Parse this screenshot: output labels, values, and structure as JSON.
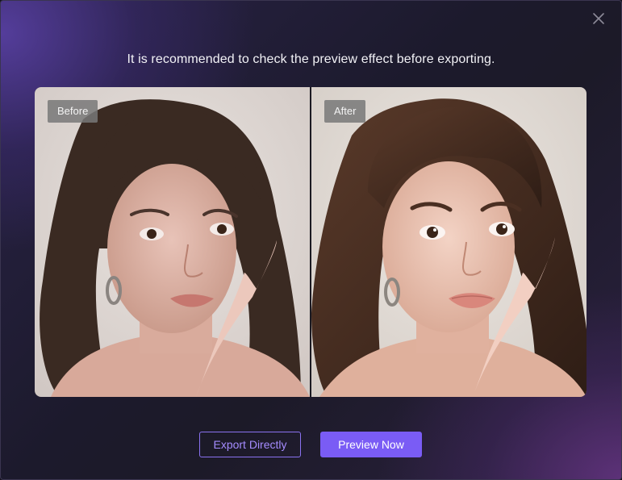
{
  "dialog": {
    "message": "It is recommended to check the preview effect before exporting.",
    "close_icon": "close-icon",
    "before_label": "Before",
    "after_label": "After",
    "export_label": "Export Directly",
    "preview_label": "Preview Now",
    "accent_color": "#7a5cf5"
  }
}
